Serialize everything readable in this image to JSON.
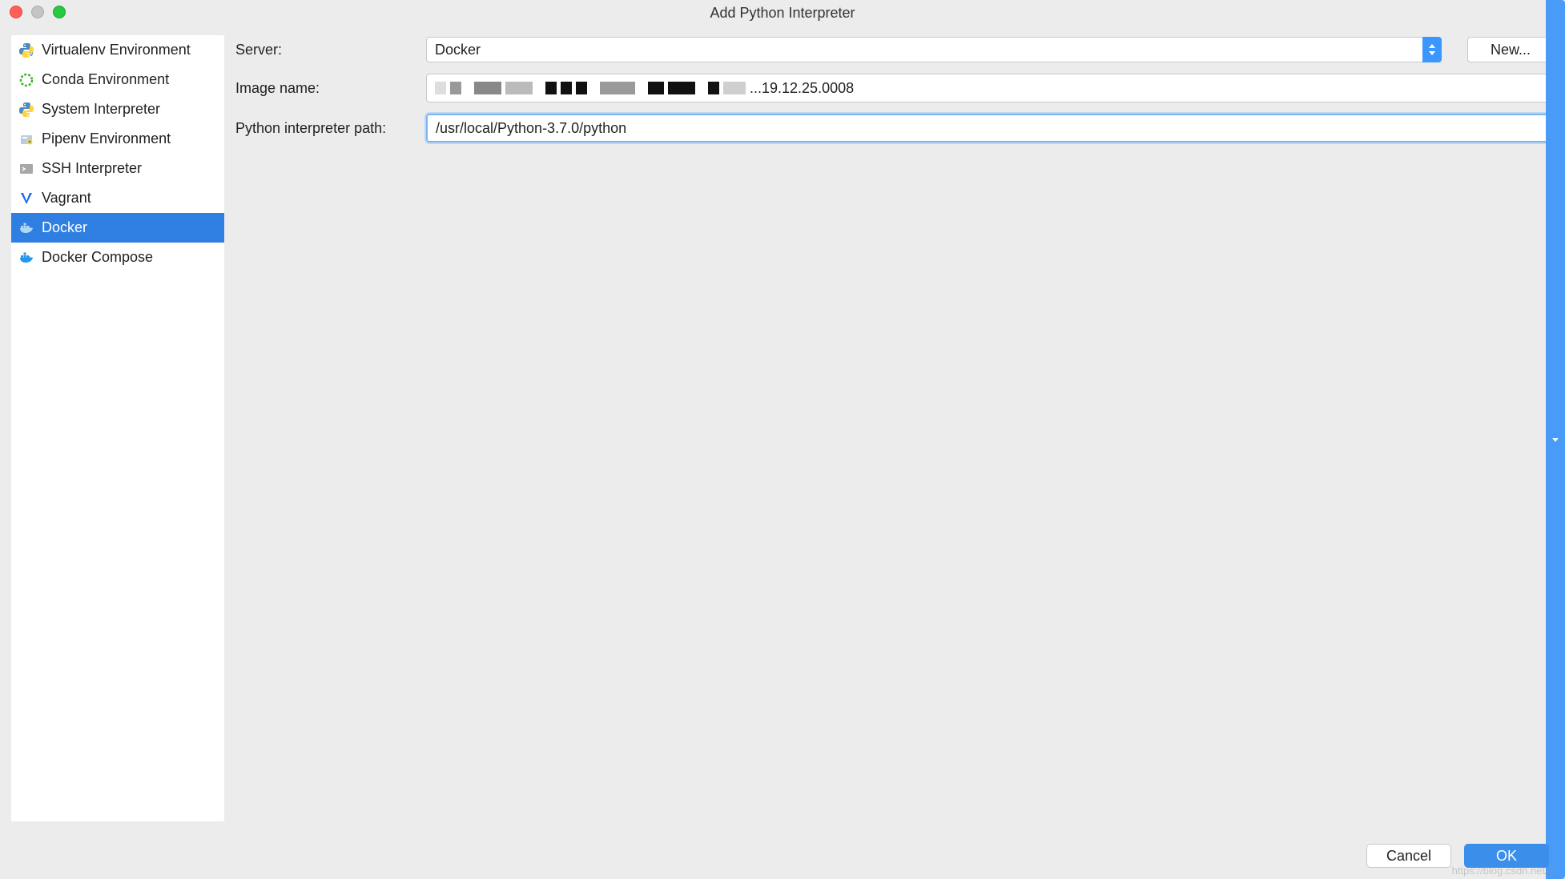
{
  "window": {
    "title": "Add Python Interpreter"
  },
  "sidebar": {
    "items": [
      {
        "label": "Virtualenv Environment",
        "icon": "python-env-icon",
        "selected": false
      },
      {
        "label": "Conda Environment",
        "icon": "conda-icon",
        "selected": false
      },
      {
        "label": "System Interpreter",
        "icon": "python-icon",
        "selected": false
      },
      {
        "label": "Pipenv Environment",
        "icon": "pipenv-icon",
        "selected": false
      },
      {
        "label": "SSH Interpreter",
        "icon": "ssh-icon",
        "selected": false
      },
      {
        "label": "Vagrant",
        "icon": "vagrant-icon",
        "selected": false
      },
      {
        "label": "Docker",
        "icon": "docker-icon",
        "selected": true
      },
      {
        "label": "Docker Compose",
        "icon": "docker-compose-icon",
        "selected": false
      }
    ]
  },
  "form": {
    "server_label": "Server:",
    "server_value": "Docker",
    "new_button": "New...",
    "image_name_label": "Image name:",
    "image_name_suffix": "...19.12.25.0008",
    "interpreter_path_label": "Python interpreter path:",
    "interpreter_path_value": "/usr/local/Python-3.7.0/python"
  },
  "footer": {
    "cancel": "Cancel",
    "ok": "OK"
  },
  "watermark": "https://blog.csdn.net/jc"
}
